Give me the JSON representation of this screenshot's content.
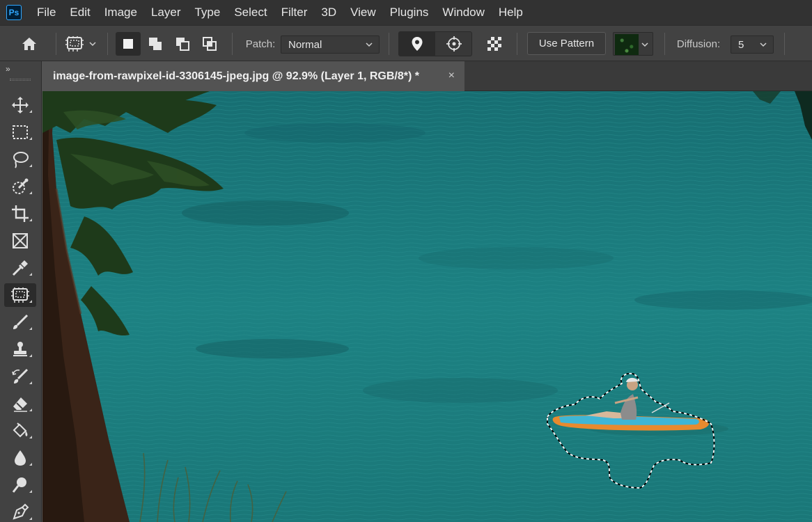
{
  "app": {
    "logo_text": "Ps"
  },
  "menu": [
    "File",
    "Edit",
    "Image",
    "Layer",
    "Type",
    "Select",
    "Filter",
    "3D",
    "View",
    "Plugins",
    "Window",
    "Help"
  ],
  "options": {
    "patch_label": "Patch:",
    "patch_value": "Normal",
    "use_pattern_label": "Use Pattern",
    "diffusion_label": "Diffusion:",
    "diffusion_value": "5"
  },
  "document": {
    "tab_title": "image-from-rawpixel-id-3306145-jpeg.jpg @ 92.9% (Layer 1, RGB/8*) *",
    "close_glyph": "×"
  },
  "toolbar": {
    "collapse_glyph": "»",
    "active_tool": "patch-tool",
    "tools": [
      "move-tool",
      "rectangular-marquee-tool",
      "lasso-tool",
      "quick-selection-tool",
      "crop-tool",
      "frame-tool",
      "eyedropper-tool",
      "patch-tool",
      "brush-tool",
      "clone-stamp-tool",
      "history-brush-tool",
      "eraser-tool",
      "paint-bucket-tool",
      "blur-tool",
      "dodge-tool",
      "pen-tool"
    ]
  },
  "colors": {
    "app_bg": "#535353",
    "menubar_bg": "#323232",
    "panel_bg": "#424242",
    "water": "#1f7f80",
    "selection_outline": "#ffffff"
  }
}
